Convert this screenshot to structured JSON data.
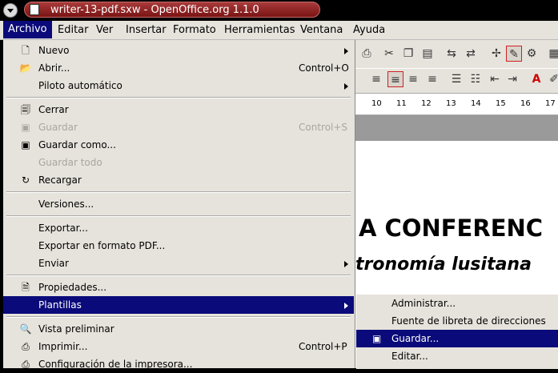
{
  "window": {
    "title": "writer-13-pdf.sxw - OpenOffice.org 1.1.0"
  },
  "menubar": [
    "Archivo",
    "Editar",
    "Ver",
    "Insertar",
    "Formato",
    "Herramientas",
    "Ventana",
    "Ayuda"
  ],
  "file_menu": {
    "nuevo": "Nuevo",
    "abrir": "Abrir...",
    "abrir_acc": "Control+O",
    "piloto": "Piloto automático",
    "cerrar": "Cerrar",
    "guardar": "Guardar",
    "guardar_acc": "Control+S",
    "guardar_como": "Guardar como...",
    "guardar_todo": "Guardar todo",
    "recargar": "Recargar",
    "versiones": "Versiones...",
    "exportar": "Exportar...",
    "exportar_pdf": "Exportar en formato PDF...",
    "enviar": "Enviar",
    "propiedades": "Propiedades...",
    "plantillas": "Plantillas",
    "vista_preliminar": "Vista preliminar",
    "imprimir": "Imprimir...",
    "imprimir_acc": "Control+P",
    "config_impresora": "Configuración de la impresora..."
  },
  "templates_submenu": {
    "administrar": "Administrar...",
    "fuente": "Fuente de libreta de direcciones",
    "guardar": "Guardar...",
    "editar": "Editar..."
  },
  "ruler_ticks": [
    "10",
    "11",
    "12",
    "13",
    "14",
    "15",
    "16",
    "17"
  ],
  "document": {
    "heading": "A CONFERENC",
    "subheading": "tronomía lusitana",
    "line3": "."
  }
}
